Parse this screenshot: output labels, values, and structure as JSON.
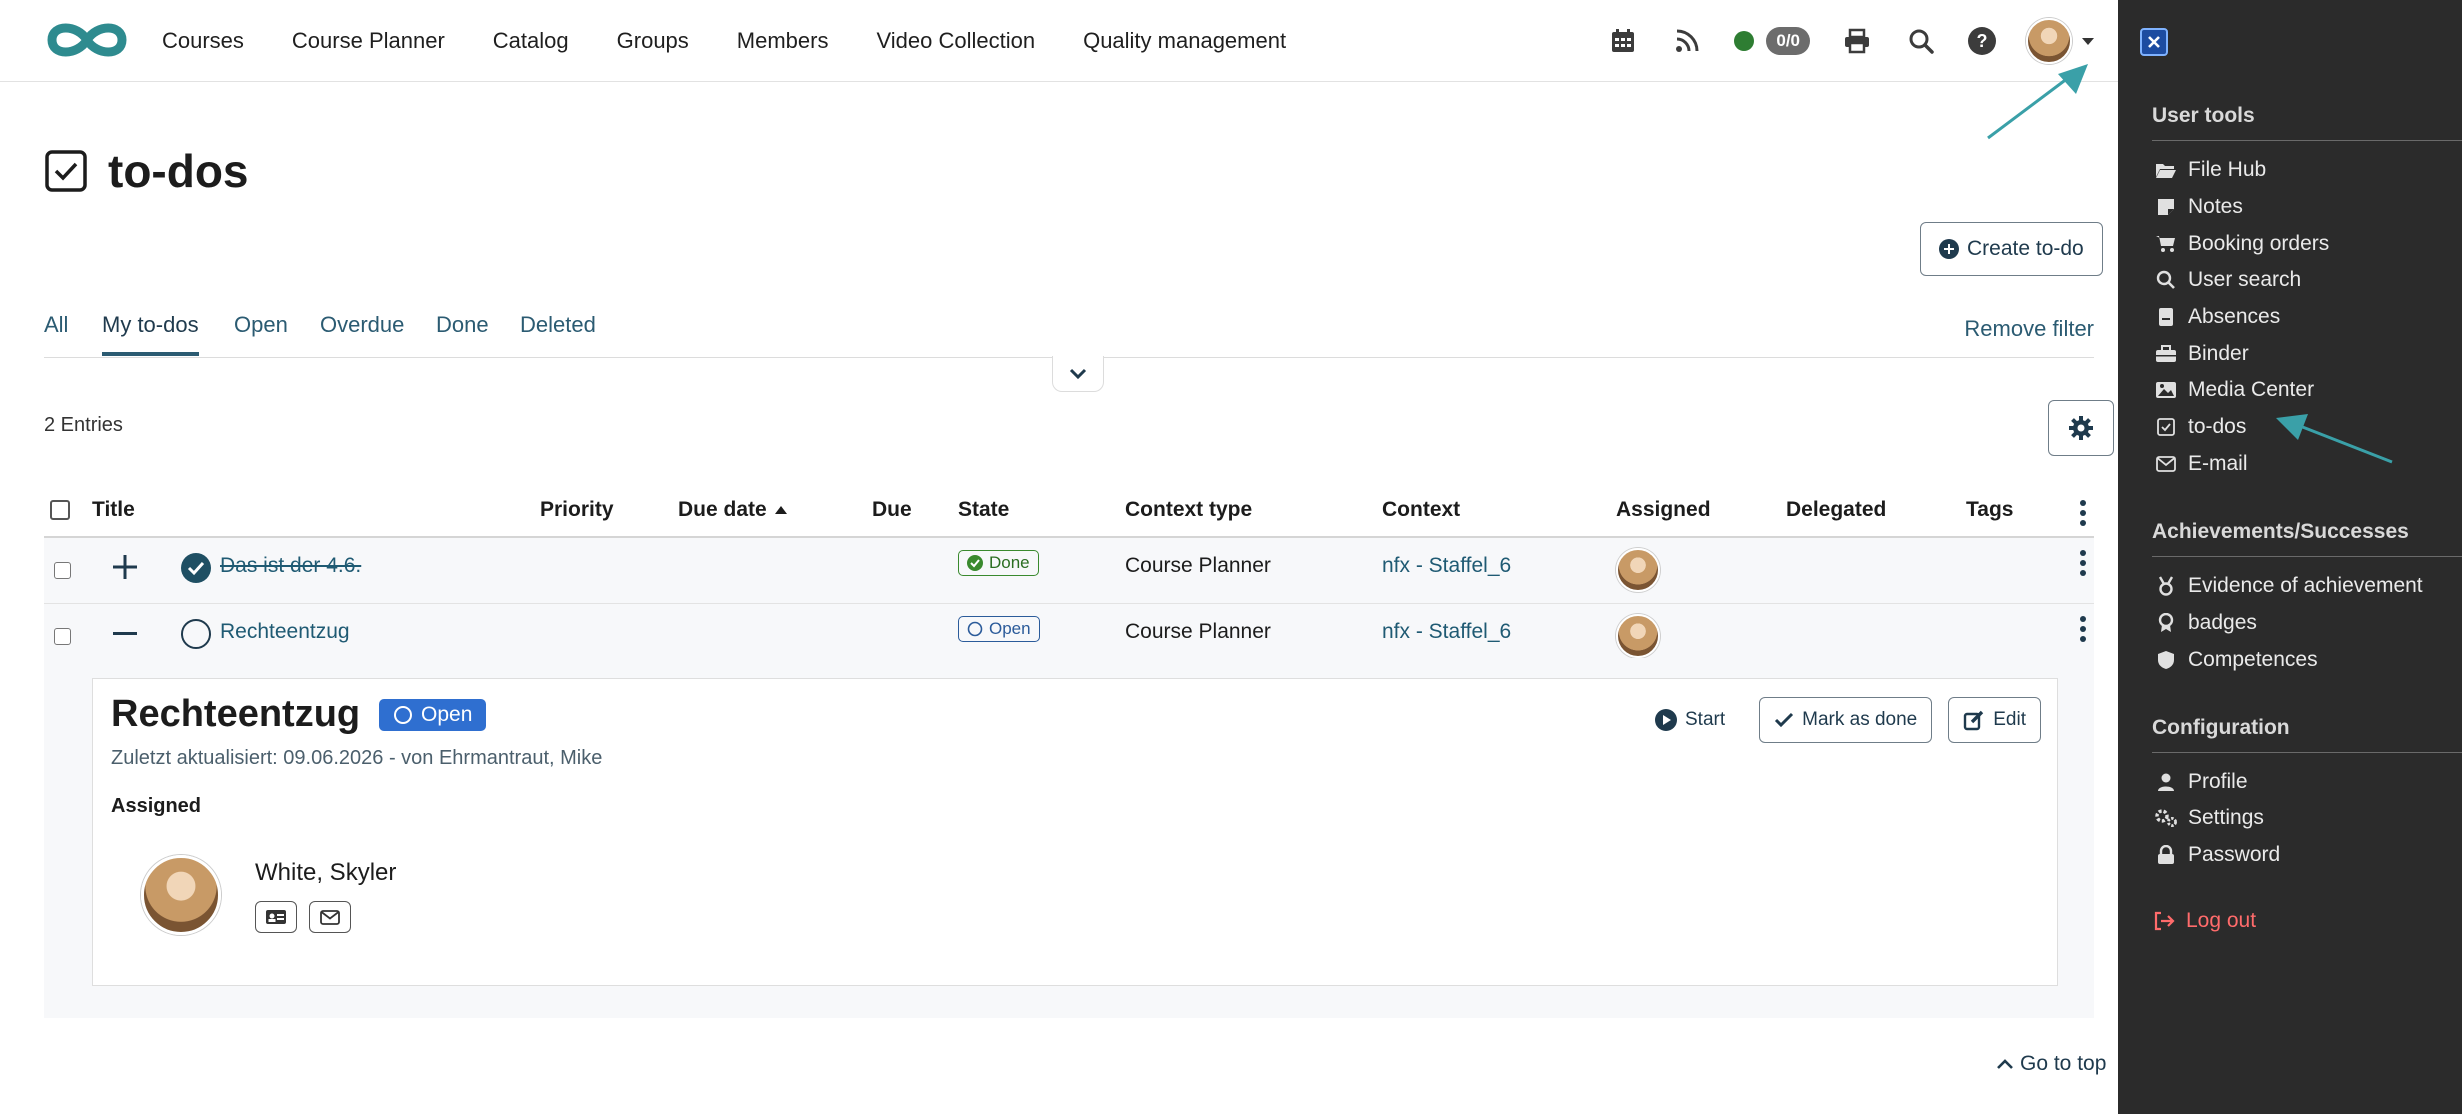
{
  "nav": {
    "items": [
      "Courses",
      "Course Planner",
      "Catalog",
      "Groups",
      "Members",
      "Video Collection",
      "Quality management"
    ],
    "counter": "0/0",
    "help": "?"
  },
  "page": {
    "title": "to-dos",
    "create_label": "Create to-do",
    "remove_filter": "Remove filter",
    "entries": "2 Entries",
    "go_to_top": "Go to top"
  },
  "filters": [
    "All",
    "My to-dos",
    "Open",
    "Overdue",
    "Done",
    "Deleted"
  ],
  "active_filter": "My to-dos",
  "table": {
    "columns": [
      "Title",
      "Priority",
      "Due date",
      "Due",
      "State",
      "Context type",
      "Context",
      "Assigned",
      "Delegated",
      "Tags"
    ],
    "rows": [
      {
        "title": "Das ist der 4.6.",
        "state": "Done",
        "context_type": "Course Planner",
        "context": "nfx - Staffel_6"
      },
      {
        "title": "Rechteentzug",
        "state": "Open",
        "context_type": "Course Planner",
        "context": "nfx - Staffel_6"
      }
    ]
  },
  "detail": {
    "title": "Rechteentzug",
    "state": "Open",
    "updated": "Zuletzt aktualisiert: 09.06.2026 - von Ehrmantraut, Mike",
    "start_label": "Start",
    "mark_done_label": "Mark as done",
    "edit_label": "Edit",
    "assigned_label": "Assigned",
    "person": "White, Skyler"
  },
  "drawer": {
    "user_tools_title": "User tools",
    "user_tools": [
      "File Hub",
      "Notes",
      "Booking orders",
      "User search",
      "Absences",
      "Binder",
      "Media Center",
      "to-dos",
      "E-mail"
    ],
    "achievements_title": "Achievements/Successes",
    "achievements": [
      "Evidence of achievement",
      "badges",
      "Competences"
    ],
    "config_title": "Configuration",
    "config": [
      "Profile",
      "Settings",
      "Password"
    ],
    "logout": "Log out"
  },
  "colors": {
    "accent": "#2b5b72",
    "logo": "#2e8b8f",
    "drawer_bg": "#2b2b2b",
    "done": "#3a8a2e",
    "open": "#2f6fd0",
    "logout": "#ff6b6b",
    "arrow": "#3aa0a8"
  }
}
